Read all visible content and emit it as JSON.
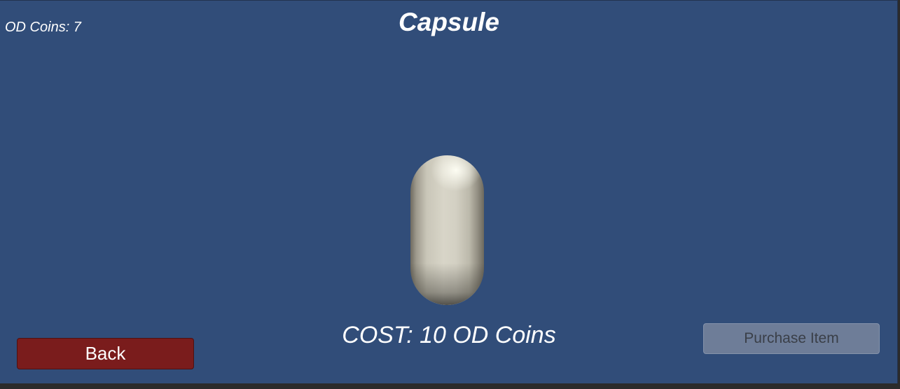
{
  "hud": {
    "coins_label": "OD Coins: 7"
  },
  "item": {
    "title": "Capsule",
    "shape": "capsule-3d-model",
    "cost_label": "COST: 10 OD Coins",
    "color": "#d6d3c6"
  },
  "buttons": {
    "back_label": "Back",
    "purchase_label": "Purchase Item",
    "purchase_enabled": false
  },
  "colors": {
    "background": "#314d79",
    "back_button": "#7a1c1c",
    "purchase_button_disabled": "#6e7d98"
  }
}
